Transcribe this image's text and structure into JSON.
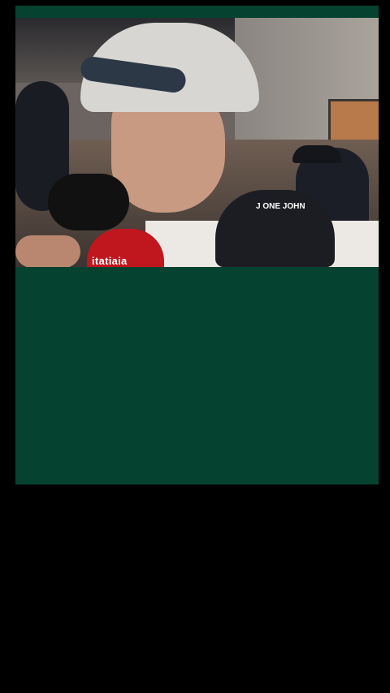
{
  "video": {
    "mic_brand_label": "itatiaia",
    "mic_foam_label": "J ONE JOHN"
  }
}
